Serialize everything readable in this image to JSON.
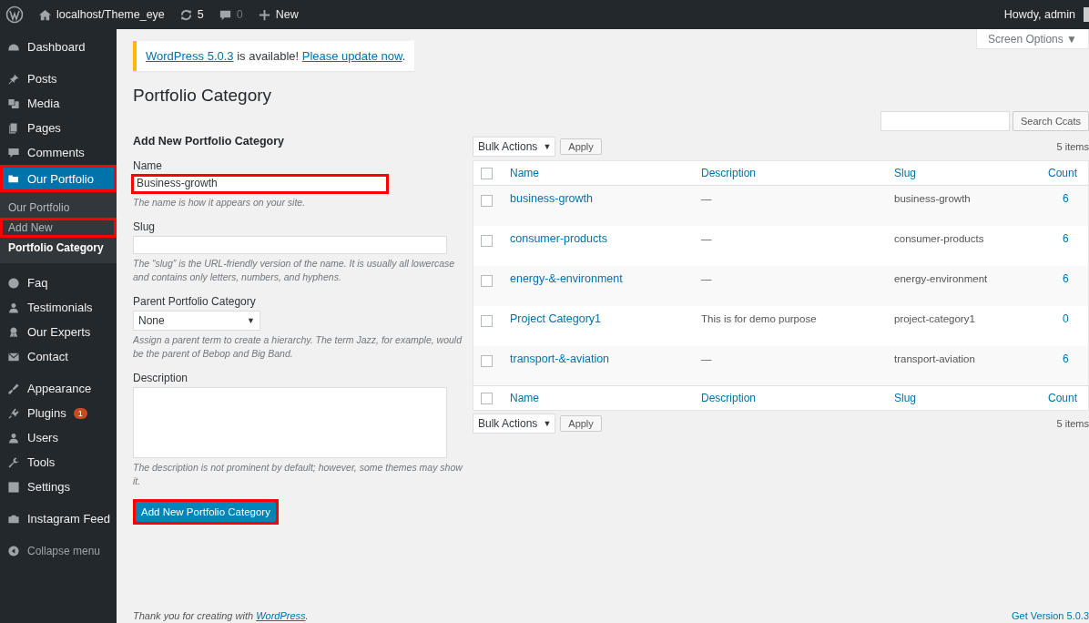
{
  "admin_bar": {
    "site": "localhost/Theme_eye",
    "updates": "5",
    "comments": "0",
    "new": "New",
    "greeting": "Howdy, admin"
  },
  "sidebar": {
    "groups": [
      [
        {
          "label": "Dashboard",
          "selected": false,
          "highlighted": false
        }
      ],
      [
        {
          "label": "Posts",
          "selected": false,
          "highlighted": false
        },
        {
          "label": "Media",
          "selected": false,
          "highlighted": false
        },
        {
          "label": "Pages",
          "selected": false,
          "highlighted": false
        },
        {
          "label": "Comments",
          "selected": false,
          "highlighted": false
        },
        {
          "label": "Our Portfolio",
          "selected": true,
          "highlighted": true,
          "submenu": [
            {
              "label": "Our Portfolio",
              "selected": false,
              "highlighted": false
            },
            {
              "label": "Add New",
              "selected": false,
              "highlighted": true
            },
            {
              "label": "Portfolio Category",
              "selected": true,
              "highlighted": false
            }
          ]
        }
      ],
      [
        {
          "label": "Faq",
          "selected": false,
          "highlighted": false
        },
        {
          "label": "Testimonials",
          "selected": false,
          "highlighted": false
        },
        {
          "label": "Our Experts",
          "selected": false,
          "highlighted": false
        },
        {
          "label": "Contact",
          "selected": false,
          "highlighted": false
        }
      ],
      [
        {
          "label": "Appearance",
          "selected": false,
          "highlighted": false
        },
        {
          "label": "Plugins",
          "selected": false,
          "highlighted": false,
          "badge": "1"
        },
        {
          "label": "Users",
          "selected": false,
          "highlighted": false
        },
        {
          "label": "Tools",
          "selected": false,
          "highlighted": false
        },
        {
          "label": "Settings",
          "selected": false,
          "highlighted": false
        }
      ],
      [
        {
          "label": "Instagram Feed",
          "selected": false,
          "highlighted": false
        }
      ],
      [
        {
          "label": "Collapse menu",
          "selected": false,
          "highlighted": false
        }
      ]
    ]
  },
  "screen_options": "Screen Options ▼",
  "notice": {
    "link": "WordPress 5.0.3",
    "text": " is available! ",
    "action": "Please update now",
    "end": "."
  },
  "title": "Portfolio Category",
  "form": {
    "heading": "Add New Portfolio Category",
    "fields": [
      {
        "kind": "text",
        "label": "Name",
        "value": "Business-growth",
        "help": "The name is how it appears on your site.",
        "highlighted": true
      },
      {
        "kind": "text",
        "label": "Slug",
        "help": "The “slug” is the URL-friendly version of the name. It is usually all lowercase and contains only letters, numbers, and hyphens.",
        "highlighted": false
      },
      {
        "kind": "select",
        "label": "Parent Portfolio Category",
        "value": "None",
        "caret": "▼",
        "help": "Assign a parent term to create a hierarchy. The term Jazz, for example, would be the parent of Bebop and Big Band."
      },
      {
        "kind": "textarea",
        "label": "Description",
        "help": "The description is not prominent by default; however, some themes may show it."
      }
    ],
    "submit": {
      "label": "Add New Portfolio Category",
      "highlighted": true
    }
  },
  "search_button": "Search Ccats",
  "top_nav": {
    "bulk_actions": "Bulk Actions",
    "caret": "▼",
    "apply": "Apply",
    "item_count": "5 items"
  },
  "table": {
    "header": {
      "checked": false,
      "columns": [
        "Name",
        "Description",
        "Slug",
        "Count"
      ]
    },
    "rows": [
      {
        "name": "business-growth",
        "description": "—",
        "slug": "business-growth",
        "count": "6",
        "checked": false
      },
      {
        "name": "consumer-products",
        "description": "—",
        "slug": "consumer-products",
        "count": "6",
        "checked": false
      },
      {
        "name": "energy-&-environment",
        "description": "—",
        "slug": "energy-environment",
        "count": "6",
        "checked": false
      },
      {
        "name": "Project Category1",
        "description": "This is for demo purpose",
        "slug": "project-category1",
        "count": "0",
        "checked": false
      },
      {
        "name": "transport-&-aviation",
        "description": "—",
        "slug": "transport-aviation",
        "count": "6",
        "checked": false
      }
    ],
    "footer": {
      "checked": false,
      "columns": [
        "Name",
        "Description",
        "Slug",
        "Count"
      ]
    }
  },
  "bottom_nav": {
    "bulk_actions": "Bulk Actions",
    "caret": "▼",
    "apply": "Apply",
    "item_count": "5 items"
  },
  "footer": {
    "text": "Thank you for creating with ",
    "link": "WordPress",
    "end": ".",
    "version": "Get Version 5.0.3"
  }
}
